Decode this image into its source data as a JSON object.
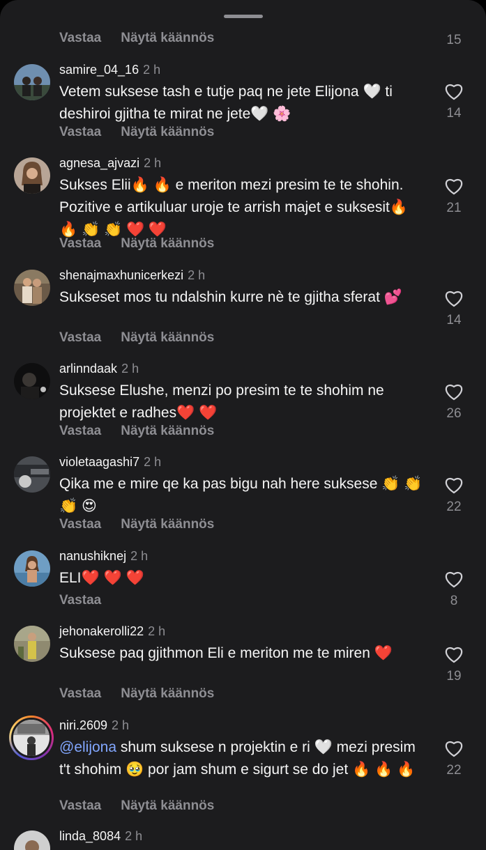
{
  "top": {
    "reply": "Vastaa",
    "translate": "Näytä käännös",
    "likes": "15"
  },
  "comments": [
    {
      "username": "samire_04_16",
      "time": "2 h",
      "text": "Vetem suksese tash e tutje paq ne jete Elijona 🤍 ti deshiroi gjitha te mirat ne jete🤍 🌸",
      "reply": "Vastaa",
      "translate": "Näytä käännös",
      "likes": "14"
    },
    {
      "username": "agnesa_ajvazi",
      "time": "2 h",
      "text": "Sukses Elii🔥 🔥  e meriton mezi presim te te shohin. Pozitive e artikuluar uroje te arrish majet e suksesit🔥 🔥 👏 👏 ❤️ ❤️",
      "reply": "Vastaa",
      "translate": "Näytä käännös",
      "likes": "21"
    },
    {
      "username": "shenajmaxhunicerkezi",
      "time": "2 h",
      "text": "Sukseset mos tu ndalshin kurre nè te gjitha sferat 💕",
      "reply": "Vastaa",
      "translate": "Näytä käännös",
      "likes": "14"
    },
    {
      "username": "arlinndaak",
      "time": "2 h",
      "text": "Suksese Elushe, menzi po presim te te shohim ne projektet e radhes❤️ ❤️",
      "reply": "Vastaa",
      "translate": "Näytä käännös",
      "likes": "26"
    },
    {
      "username": "violetaagashi7",
      "time": "2 h",
      "text": "Qika me e mire qe ka pas bigu nah here suksese 👏 👏 👏 😍",
      "reply": "Vastaa",
      "translate": "Näytä käännös",
      "likes": "22"
    },
    {
      "username": "nanushiknej",
      "time": "2 h",
      "text": "ELI❤️ ❤️ ❤️",
      "reply": "Vastaa",
      "translate": "",
      "likes": "8"
    },
    {
      "username": "jehonakerolli22",
      "time": "2 h",
      "text": "Suksese paq gjithmon Eli e meriton me te miren ❤️",
      "reply": "Vastaa",
      "translate": "Näytä käännös",
      "likes": "19"
    },
    {
      "username": "niri.2609",
      "time": "2 h",
      "mention": "@elijona",
      "text": " shum suksese n projektin e ri 🤍  mezi presim t't shohim 🥹  por  jam shum e sigurt se do jet  🔥 🔥 🔥",
      "reply": "Vastaa",
      "translate": "Näytä käännös",
      "likes": "22"
    },
    {
      "username": "linda_8084",
      "time": "2 h"
    }
  ],
  "colors": {
    "background": "#1c1c1e",
    "secondary": "#8e8e93",
    "mention": "#82a7ff"
  }
}
